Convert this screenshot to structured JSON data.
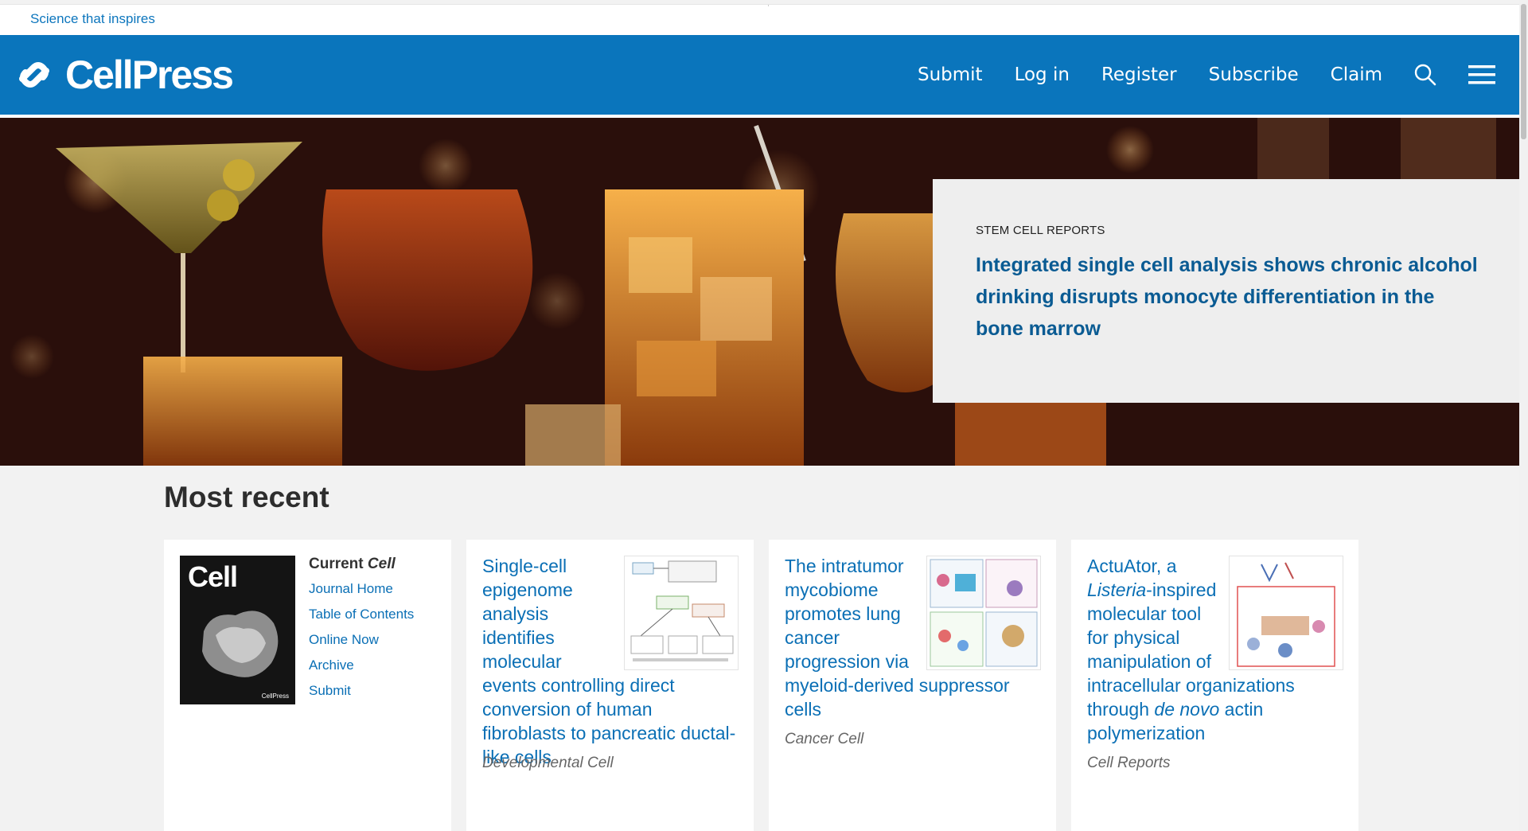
{
  "top_bar": {
    "tagline": "Science that inspires"
  },
  "header": {
    "brand": "CellPress",
    "nav": [
      "Submit",
      "Log in",
      "Register",
      "Subscribe",
      "Claim"
    ]
  },
  "hero": {
    "kicker": "STEM CELL REPORTS",
    "title": "Integrated single cell analysis shows chronic alcohol drinking disrupts monocyte differentiation in the bone marrow"
  },
  "most_recent": {
    "heading": "Most recent",
    "journal_card": {
      "title_prefix": "Current ",
      "title_journal": "Cell",
      "cover_word": "Cell",
      "cover_brand": "CellPress",
      "links": [
        "Journal Home",
        "Table of Contents",
        "Online Now",
        "Archive",
        "Submit"
      ]
    },
    "articles": [
      {
        "title": "Single-cell epigenome analysis identifies molecular events controlling direct conversion of human fibroblasts to pancreatic ductal-like cells",
        "journal": "Developmental Cell"
      },
      {
        "title": "The intratumor mycobiome promotes lung cancer progression via myeloid-derived suppressor cells",
        "journal": "Cancer Cell"
      },
      {
        "title_parts": [
          "ActuAtor, a ",
          "Listeria",
          "-inspired molecular tool for physical manipulation of intracellular organizations through ",
          "de novo",
          " actin polymerization"
        ],
        "journal": "Cell Reports"
      }
    ]
  },
  "colors": {
    "brand_blue": "#0a75bc",
    "link_blue": "#0a6fb5",
    "hero_title": "#0a5b93"
  },
  "icons": [
    "cellpress-logo-icon",
    "search-icon",
    "menu-icon"
  ]
}
